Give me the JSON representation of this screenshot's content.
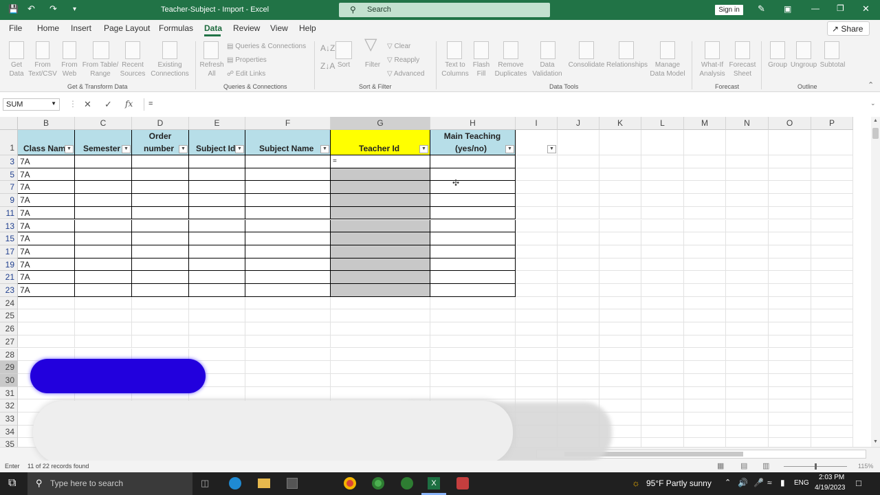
{
  "window": {
    "title": "Teacher-Subject - Import  -  Excel",
    "search_placeholder": "Search",
    "sign_in": "Sign in",
    "accent": "#217346"
  },
  "menu": {
    "items": [
      "File",
      "Home",
      "Insert",
      "Page Layout",
      "Formulas",
      "Data",
      "Review",
      "View",
      "Help"
    ],
    "active": "Data",
    "share": "Share"
  },
  "ribbon": {
    "groups": [
      "Get & Transform Data",
      "Queries & Connections",
      "Sort & Filter",
      "Data Tools",
      "Forecast",
      "Outline"
    ],
    "buttons": {
      "get_data": [
        "Get",
        "Data"
      ],
      "from_text": [
        "From",
        "Text/CSV"
      ],
      "from_web": [
        "From",
        "Web"
      ],
      "from_table": [
        "From Table/",
        "Range"
      ],
      "recent": [
        "Recent",
        "Sources"
      ],
      "existing": [
        "Existing",
        "Connections"
      ],
      "refresh": [
        "Refresh",
        "All"
      ],
      "queries": "Queries & Connections",
      "properties": "Properties",
      "edit_links": "Edit Links",
      "sort": "Sort",
      "filter": "Filter",
      "clear": "Clear",
      "reapply": "Reapply",
      "advanced": "Advanced",
      "text_cols": [
        "Text to",
        "Columns"
      ],
      "flash": [
        "Flash",
        "Fill"
      ],
      "remove_dup": [
        "Remove",
        "Duplicates"
      ],
      "validation": [
        "Data",
        "Validation"
      ],
      "consolidate": "Consolidate",
      "relationships": "Relationships",
      "manage": [
        "Manage",
        "Data Model"
      ],
      "whatif": [
        "What-If",
        "Analysis"
      ],
      "forecast_sheet": [
        "Forecast",
        "Sheet"
      ],
      "group": "Group",
      "ungroup": "Ungroup",
      "subtotal": "Subtotal"
    }
  },
  "formula_bar": {
    "name_box": "SUM",
    "formula": "=",
    "fx": "fx"
  },
  "sheet": {
    "columns": [
      "B",
      "C",
      "D",
      "E",
      "F",
      "G",
      "H",
      "I",
      "J",
      "K",
      "L",
      "M",
      "N",
      "O",
      "P"
    ],
    "rows": [
      "1",
      "3",
      "5",
      "7",
      "9",
      "11",
      "13",
      "15",
      "17",
      "19",
      "21",
      "23",
      "24",
      "25",
      "26",
      "27",
      "28",
      "29",
      "30",
      "31",
      "32",
      "33",
      "34",
      "35"
    ],
    "headers": {
      "class_name": "Class Name",
      "semester": "Semester",
      "order_1": "Order",
      "order_2": "number",
      "subject_id": "Subject Id",
      "subject_name": "Subject Name",
      "teacher_id": "Teacher Id",
      "main_1": "Main Teaching",
      "main_2": "(yes/no)"
    },
    "class_values": [
      "7A",
      "7A",
      "7A",
      "7A",
      "7A",
      "7A",
      "7A",
      "7A",
      "7A",
      "7A",
      "7A"
    ],
    "editing_cell": "=",
    "header_color": "#b7dee8",
    "teacher_header_color": "#ffff00",
    "selection_color": "#c8c8c8"
  },
  "status": {
    "mode": "Enter",
    "records": "11 of 22 records found",
    "zoom": "115%"
  },
  "taskbar": {
    "search_placeholder": "Type here to search",
    "weather": "95°F  Partly sunny",
    "lang": "ENG",
    "time": "2:03 PM",
    "date": "4/19/2023"
  }
}
